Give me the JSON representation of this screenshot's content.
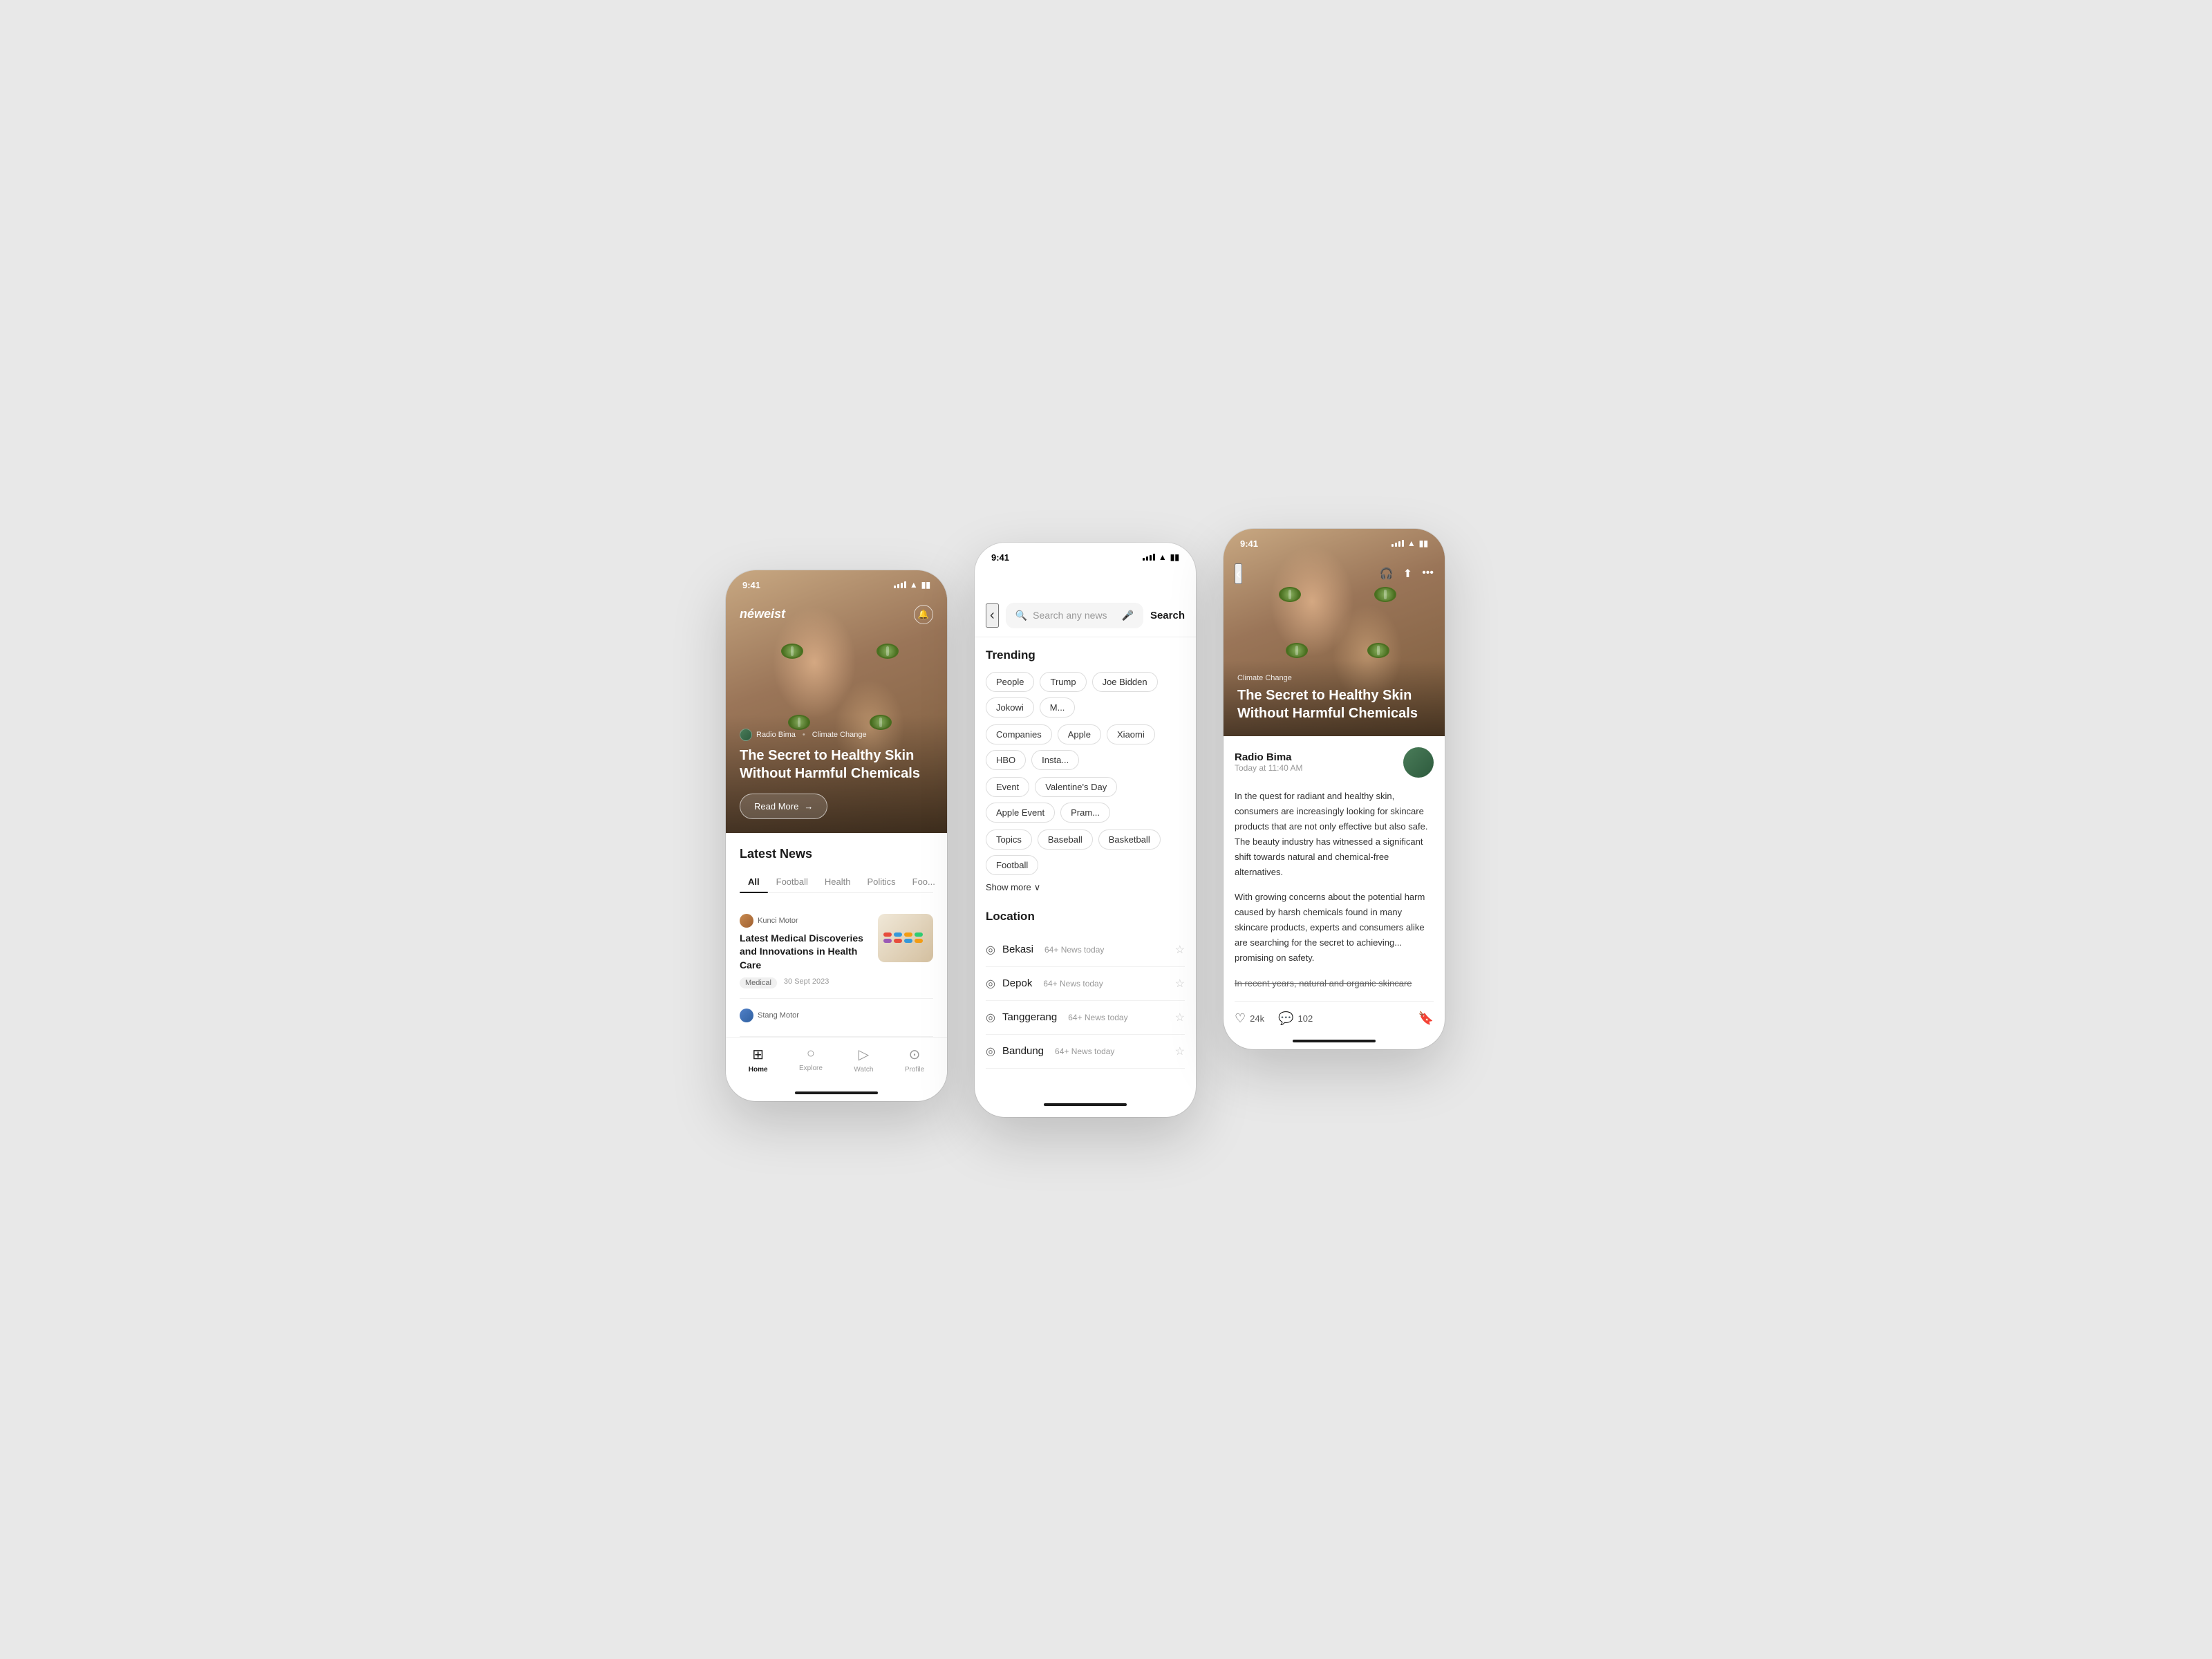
{
  "phone1": {
    "status": {
      "time": "9:41",
      "signal": true,
      "wifi": true,
      "battery": true
    },
    "header": {
      "logo": "néweist",
      "bell_label": "🔔"
    },
    "hero": {
      "source": "Radio Bima",
      "category": "Climate Change",
      "title": "The Secret to Healthy Skin Without Harmful Chemicals",
      "read_more": "Read More"
    },
    "latest_news": {
      "section_title": "Latest News",
      "tabs": [
        "All",
        "Football",
        "Health",
        "Politics",
        "Foo"
      ],
      "active_tab": "All",
      "items": [
        {
          "source": "Kunci Motor",
          "title": "Latest Medical Discoveries and Innovations in Health Care",
          "tag": "Medical",
          "date": "30 Sept 2023"
        },
        {
          "source": "Stang Motor",
          "title": "",
          "tag": "",
          "date": ""
        }
      ]
    },
    "bottom_nav": {
      "items": [
        {
          "icon": "⊞",
          "label": "Home",
          "active": true
        },
        {
          "icon": "○",
          "label": "Explore",
          "active": false
        },
        {
          "icon": "▷",
          "label": "Watch",
          "active": false
        },
        {
          "icon": "⊙",
          "label": "Profile",
          "active": false
        }
      ]
    }
  },
  "phone2": {
    "status": {
      "time": "9:41"
    },
    "search": {
      "placeholder": "Search any news",
      "button_label": "Search",
      "back_icon": "‹"
    },
    "trending": {
      "section_label": "Trending",
      "tags": [
        "People",
        "Trump",
        "Joe Bidden",
        "Jokowi",
        "M...",
        "Companies",
        "Apple",
        "Xiaomi",
        "HBO",
        "Insta...",
        "Event",
        "Valentine's Day",
        "Apple Event",
        "Pram...",
        "Topics",
        "Baseball",
        "Basketball",
        "Football"
      ],
      "show_more": "Show more"
    },
    "location": {
      "section_label": "Location",
      "items": [
        {
          "name": "Bekasi",
          "count": "64+ News today"
        },
        {
          "name": "Depok",
          "count": "64+ News today"
        },
        {
          "name": "Tanggerang",
          "count": "64+ News today"
        },
        {
          "name": "Bandung",
          "count": "64+ News today"
        }
      ]
    }
  },
  "phone3": {
    "status": {
      "time": "9:41"
    },
    "top_nav": {
      "back": "‹",
      "headphone_icon": "🎧",
      "share_icon": "⬆",
      "more_icon": "•••"
    },
    "hero": {
      "category": "Climate Change",
      "title": "The Secret to Healthy Skin Without Harmful Chemicals"
    },
    "article": {
      "author": "Radio Bima",
      "time": "Today at 11:40 AM",
      "body_1": "In the quest for radiant and healthy skin, consumers are increasingly looking for skincare products that are not only effective but also safe. The beauty industry has witnessed a significant shift towards natural and chemical-free alternatives.",
      "body_2": "With growing concerns about the potential harm caused by harsh chemicals found in many skincare products, experts and consumers alike are searching for the secret to achieving",
      "body_2_end": "omising on safety.",
      "body_3_strikethrough": "In recent years, natural and org",
      "body_3_end": "anic skincare"
    },
    "actions": {
      "likes": "24k",
      "comments": "102",
      "like_label": "24k",
      "comment_label": "102"
    }
  }
}
